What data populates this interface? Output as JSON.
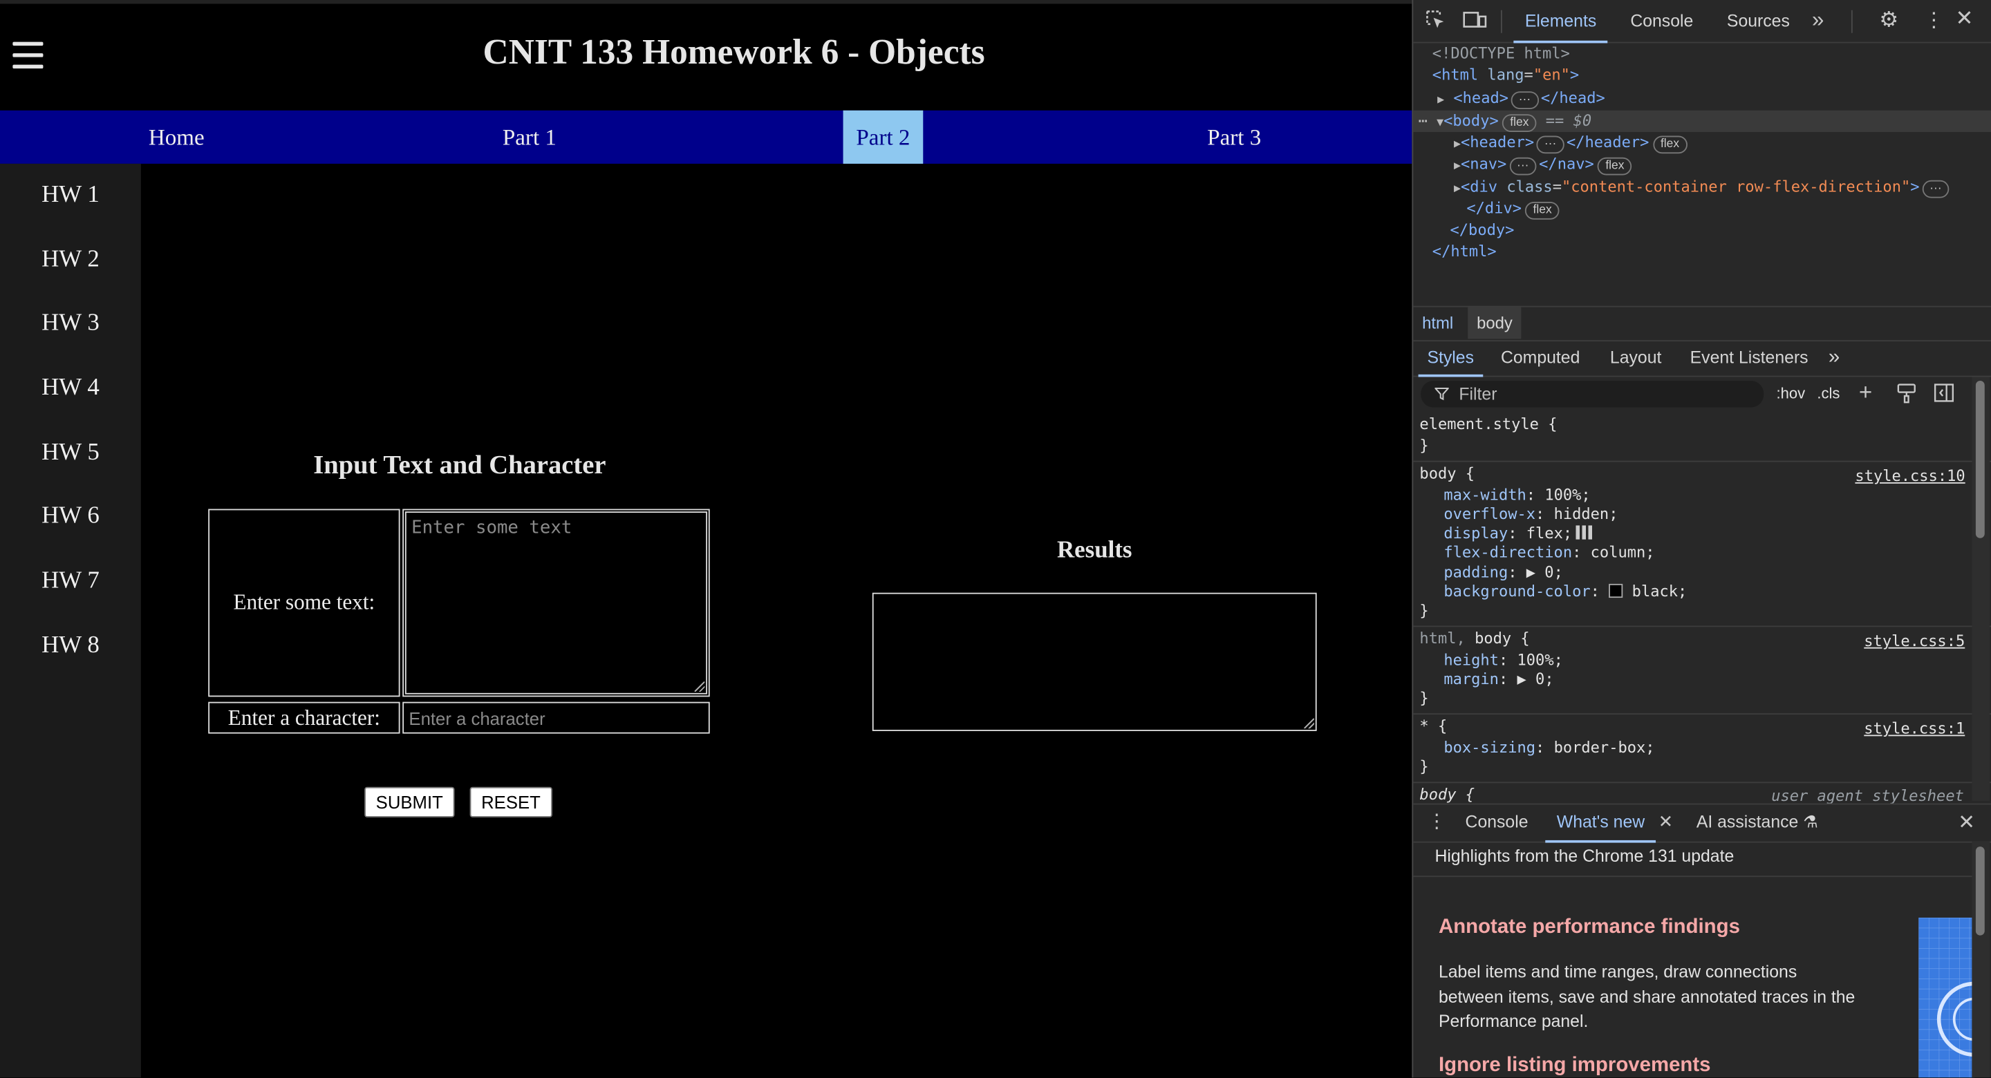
{
  "page": {
    "title": "CNIT 133 Homework 6 - Objects",
    "nav": [
      "Home",
      "Part 1",
      "Part 2",
      "Part 3"
    ],
    "nav_active": "Part 2",
    "sidebar": [
      "HW 1",
      "HW 2",
      "HW 3",
      "HW 4",
      "HW 5",
      "HW 6",
      "HW 7",
      "HW 8"
    ],
    "form": {
      "heading": "Input Text and Character",
      "text_label": "Enter some text:",
      "text_placeholder": "Enter some text",
      "char_label": "Enter a character:",
      "char_placeholder": "Enter a character",
      "submit_label": "SUBMIT",
      "reset_label": "RESET"
    },
    "results": {
      "heading": "Results",
      "value": ""
    }
  },
  "devtools": {
    "tabs": [
      "Elements",
      "Console",
      "Sources"
    ],
    "active_tab": "Elements",
    "more_tabs": "»",
    "dom": {
      "doctype": "<!DOCTYPE html>",
      "html_open": "<html",
      "html_attr": "lang",
      "html_attr_value": "\"en\"",
      "html_close_bracket": ">",
      "head_open": "<head>",
      "head_close": "</head>",
      "body_open": "<body>",
      "body_pill": "flex",
      "body_marker": "== $0",
      "header_open": "<header>",
      "header_close": "</header>",
      "header_pill": "flex",
      "nav_open": "<nav>",
      "nav_close": "</nav>",
      "nav_pill": "flex",
      "div_open": "<div",
      "div_attr": "class",
      "div_attr_value": "\"content-container row-flex-direction\"",
      "div_close_bracket": ">",
      "div_close": "</div>",
      "div_pill": "flex",
      "body_close": "</body>",
      "html_close": "</html>"
    },
    "breadcrumbs": [
      "html",
      "body"
    ],
    "style_tabs": [
      "Styles",
      "Computed",
      "Layout",
      "Event Listeners"
    ],
    "style_tabs_more": "»",
    "filter_placeholder": "Filter",
    "filter_hov": ":hov",
    "filter_cls": ".cls",
    "rules": {
      "element_style": "element.style {",
      "close_brace": "}",
      "body_selector": "body {",
      "body_source": "style.css:10",
      "body_props": [
        {
          "name": "max-width",
          "value": "100%;"
        },
        {
          "name": "overflow-x",
          "value": "hidden;"
        },
        {
          "name": "display",
          "value": "flex;"
        },
        {
          "name": "flex-direction",
          "value": "column;"
        },
        {
          "name": "padding",
          "value": "▶ 0;"
        },
        {
          "name": "background-color",
          "value": "black;"
        }
      ],
      "htmlbody_selector_a": "html,",
      "htmlbody_selector_b": "body {",
      "htmlbody_source": "style.css:5",
      "htmlbody_props": [
        {
          "name": "height",
          "value": "100%;"
        },
        {
          "name": "margin",
          "value": "▶ 0;"
        }
      ],
      "star_selector": "* {",
      "star_source": "style.css:1",
      "star_props": [
        {
          "name": "box-sizing",
          "value": "border-box;"
        }
      ],
      "ua_selector": "body {",
      "ua_source": "user agent stylesheet"
    },
    "drawer": {
      "tabs": [
        "Console",
        "What's new",
        "AI assistance"
      ],
      "active_tab": "What's new",
      "highlights": "Highlights from the Chrome 131 update",
      "feature1_title": "Annotate performance findings",
      "feature1_body": "Label items and time ranges, draw connections between items, save and share annotated traces in the Performance panel.",
      "feature2_title": "Ignore listing improvements"
    },
    "colors": {
      "accent": "#9fc5f8",
      "nav_bg": "#00008b",
      "nav_active_bg": "#8ec8f0"
    }
  }
}
